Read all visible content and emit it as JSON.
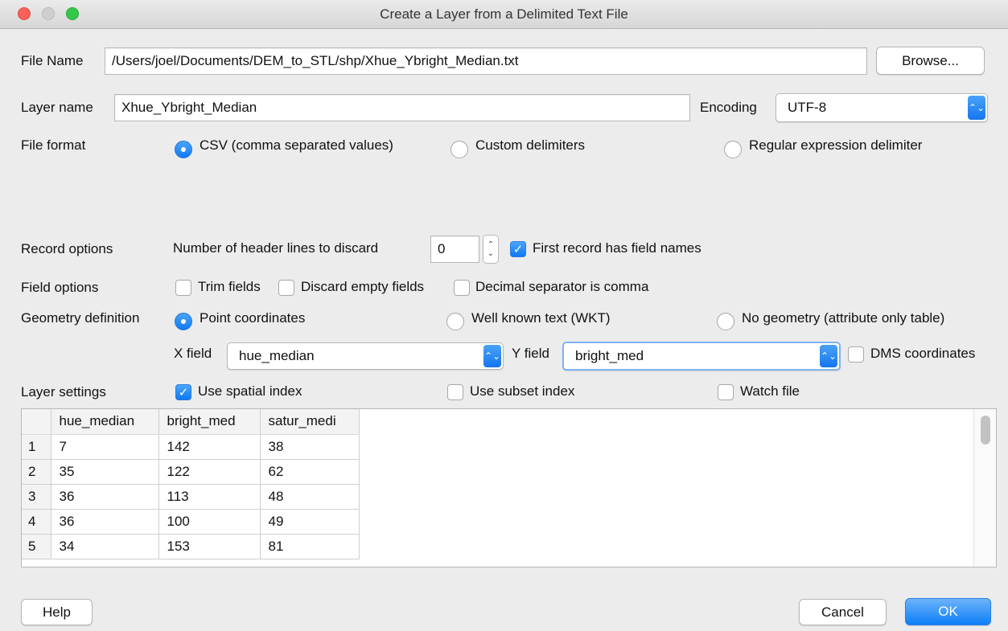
{
  "window": {
    "title": "Create a Layer from a Delimited Text File"
  },
  "file": {
    "label": "File Name",
    "value": "/Users/joel/Documents/DEM_to_STL/shp/Xhue_Ybright_Median.txt",
    "browse_label": "Browse..."
  },
  "layer": {
    "name_label": "Layer name",
    "name_value": "Xhue_Ybright_Median",
    "encoding_label": "Encoding",
    "encoding_value": "UTF-8"
  },
  "file_format": {
    "label": "File format",
    "options": [
      {
        "label": "CSV (comma separated values)",
        "selected": true
      },
      {
        "label": "Custom delimiters",
        "selected": false
      },
      {
        "label": "Regular expression delimiter",
        "selected": false
      }
    ]
  },
  "record_options": {
    "label": "Record options",
    "header_lines_label": "Number of header lines to discard",
    "header_lines_value": "0",
    "first_record_label": "First record has field names",
    "first_record_checked": true
  },
  "field_options": {
    "label": "Field options",
    "items": [
      {
        "label": "Trim fields",
        "checked": false
      },
      {
        "label": "Discard empty fields",
        "checked": false
      },
      {
        "label": "Decimal separator is comma",
        "checked": false
      }
    ]
  },
  "geometry": {
    "label": "Geometry definition",
    "options": [
      {
        "label": "Point coordinates",
        "selected": true
      },
      {
        "label": "Well known text (WKT)",
        "selected": false
      },
      {
        "label": "No geometry (attribute only table)",
        "selected": false
      }
    ],
    "x_field_label": "X field",
    "x_field_value": "hue_median",
    "y_field_label": "Y field",
    "y_field_value": "bright_med",
    "dms_label": "DMS coordinates",
    "dms_checked": false
  },
  "layer_settings": {
    "label": "Layer settings",
    "items": [
      {
        "label": "Use spatial index",
        "checked": true
      },
      {
        "label": "Use subset index",
        "checked": false
      },
      {
        "label": "Watch file",
        "checked": false
      }
    ]
  },
  "preview_table": {
    "columns": [
      "hue_median",
      "bright_med",
      "satur_medi"
    ],
    "rows": [
      {
        "num": "1",
        "cells": [
          "7",
          "142",
          "38"
        ]
      },
      {
        "num": "2",
        "cells": [
          "35",
          "122",
          "62"
        ]
      },
      {
        "num": "3",
        "cells": [
          "36",
          "113",
          "48"
        ]
      },
      {
        "num": "4",
        "cells": [
          "36",
          "100",
          "49"
        ]
      },
      {
        "num": "5",
        "cells": [
          "34",
          "153",
          "81"
        ]
      }
    ]
  },
  "footer": {
    "help_label": "Help",
    "cancel_label": "Cancel",
    "ok_label": "OK"
  },
  "icons": {
    "check": "✓",
    "updown": "⌃⌄"
  }
}
